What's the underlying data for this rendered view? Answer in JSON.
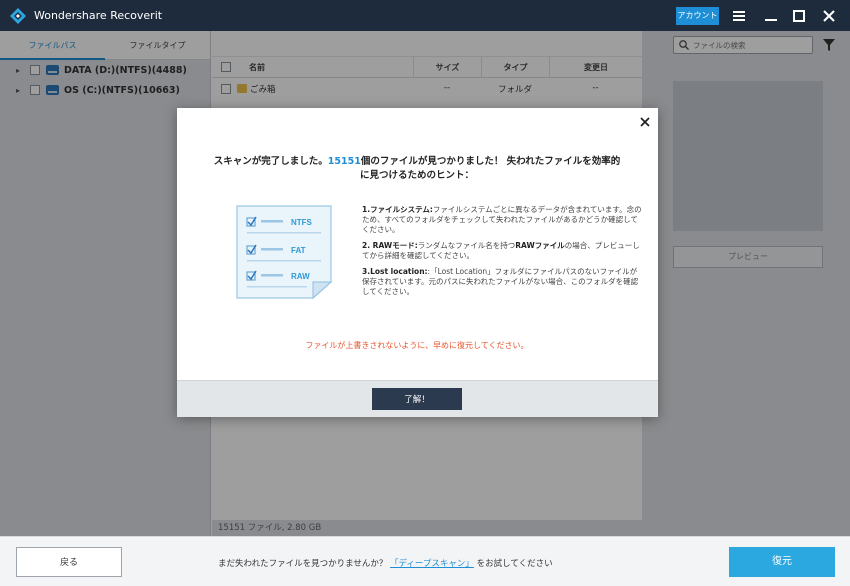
{
  "titlebar": {
    "app_title": "Wondershare Recoverit",
    "account_label": "アカウント",
    "icons": [
      "menu-icon",
      "minimize-icon",
      "maximize-icon",
      "close-icon"
    ]
  },
  "left_pane": {
    "tabs": [
      {
        "label": "ファイルパス",
        "active": true
      },
      {
        "label": "ファイルタイプ",
        "active": false
      }
    ],
    "drives": [
      {
        "label": "DATA (D:)(NTFS)(4488)"
      },
      {
        "label": "OS (C:)(NTFS)(10663)"
      }
    ]
  },
  "file_list": {
    "columns": [
      "名前",
      "サイズ",
      "タイプ",
      "変更日"
    ],
    "rows": [
      {
        "name": "ごみ箱",
        "size": "--",
        "type": "フォルダ",
        "modified": "--"
      }
    ],
    "status": "15151 ファイル, 2.80  GB"
  },
  "right_pane": {
    "search_placeholder": "ファイルの検索",
    "preview_label": "プレビュー"
  },
  "dialog": {
    "title_before": "スキャンが完了しました。",
    "title_count": "15151",
    "title_after": "個のファイルが見つかりました！ 失われたファイルを効率的",
    "title_line2": "に見つけるためのヒント：",
    "illus_labels": [
      "NTFS",
      "FAT",
      "RAW"
    ],
    "tip1_head": "1.ファイルシステム:",
    "tip1_body": "ファイルシステムごとに異なるデータが含まれています。念のため、すべてのフォルダをチェックして失われたファイルがあるかどうか確認してください。",
    "tip2_head": "2. RAWモード:",
    "tip2_body_a": "ランダムなファイル名を持つ",
    "tip2_body_bold": "RAWファイル",
    "tip2_body_b": "の場合、プレビューしてから詳細を確認してください。",
    "tip3_head": "3.Lost location:",
    "tip3_body": ":「Lost Location」フォルダにファイルパスのないファイルが保存されています。元のパスに失われたファイルがない場合、このフォルダを確認してください。",
    "warning": "ファイルが上書きされないように、早めに復元してください。",
    "ok_label": "了解！"
  },
  "footer": {
    "back_label": "戻る",
    "message_before": "まだ失われたファイルを見つかりませんか？",
    "message_link": "「ディープスキャン」",
    "message_after": "をお試してください",
    "recover_label": "復元"
  },
  "colors": {
    "titlebar": "#1e2b3c",
    "accent": "#1e8fd6",
    "warning": "#e8542c",
    "recover_button": "#2ba8e0",
    "ok_button": "#2c3a4f"
  }
}
